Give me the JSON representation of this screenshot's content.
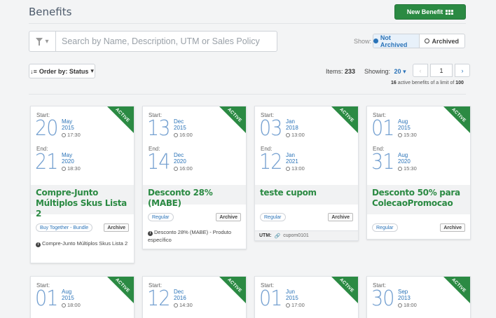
{
  "header": {
    "title": "Benefits",
    "new_button_label": "New Benefit"
  },
  "search": {
    "placeholder": "Search by Name, Description, UTM or Sales Policy"
  },
  "filter": {
    "show_label": "Show:",
    "not_archived_label": "Not Archived",
    "archived_label": "Archived"
  },
  "toolbar": {
    "order_label": "Order by: Status",
    "items_label": "Items:",
    "items_count": "233",
    "showing_label": "Showing:",
    "showing_value": "20",
    "page": "1",
    "limit_count": "16",
    "limit_text_mid": "active benefits of a limit of",
    "limit_max": "100"
  },
  "colors": {
    "accent_green": "#2b8a43",
    "accent_blue": "#2a73b8"
  },
  "cards": [
    {
      "status": "ACTIVE",
      "start_label": "Start:",
      "start_day": "20",
      "start_month": "May",
      "start_year": "2015",
      "start_time": "17:30",
      "end_label": "End:",
      "end_day": "21",
      "end_month": "May",
      "end_year": "2020",
      "end_time": "18:30",
      "name": "Compre-Junto Múltiplos Skus Lista 2",
      "tag": "Buy Together - Bundle",
      "archive_label": "Archive",
      "description": "Compre-Junto Múltiplos Skus Lista 2"
    },
    {
      "status": "ACTIVE",
      "start_label": "Start:",
      "start_day": "13",
      "start_month": "Dec",
      "start_year": "2015",
      "start_time": "16:00",
      "end_label": "End:",
      "end_day": "14",
      "end_month": "Dec",
      "end_year": "2020",
      "end_time": "16:00",
      "name": "Desconto 28% (MABE)",
      "tag": "Regular",
      "archive_label": "Archive",
      "description": "Desconto 28% (MABE) - Produto específico"
    },
    {
      "status": "ACTIVE",
      "start_label": "Start:",
      "start_day": "03",
      "start_month": "Jan",
      "start_year": "2018",
      "start_time": "13:00",
      "end_label": "End:",
      "end_day": "12",
      "end_month": "Jan",
      "end_year": "2021",
      "end_time": "13:00",
      "name": "teste cupom",
      "tag": "Regular",
      "archive_label": "Archive",
      "utm_label": "UTM:",
      "utm_value": "cupom0101"
    },
    {
      "status": "ACTIVE",
      "start_label": "Start:",
      "start_day": "01",
      "start_month": "Aug",
      "start_year": "2015",
      "start_time": "15:30",
      "end_label": "End:",
      "end_day": "31",
      "end_month": "Aug",
      "end_year": "2020",
      "end_time": "15:30",
      "name": "Desconto 50% para ColecaoPromocao",
      "tag": "Regular",
      "archive_label": "Archive"
    },
    {
      "status": "ACTIVE",
      "start_label": "Start:",
      "start_day": "01",
      "start_month": "Aug",
      "start_year": "2015",
      "start_time": "18:00"
    },
    {
      "status": "ACTIVE",
      "start_label": "Start:",
      "start_day": "12",
      "start_month": "Dec",
      "start_year": "2016",
      "start_time": "14:30"
    },
    {
      "status": "ACTIVE",
      "start_label": "Start:",
      "start_day": "01",
      "start_month": "Jun",
      "start_year": "2015",
      "start_time": "17:00"
    },
    {
      "status": "ACTIVE",
      "start_label": "Start:",
      "start_day": "30",
      "start_month": "Sep",
      "start_year": "2013",
      "start_time": "18:00"
    }
  ]
}
